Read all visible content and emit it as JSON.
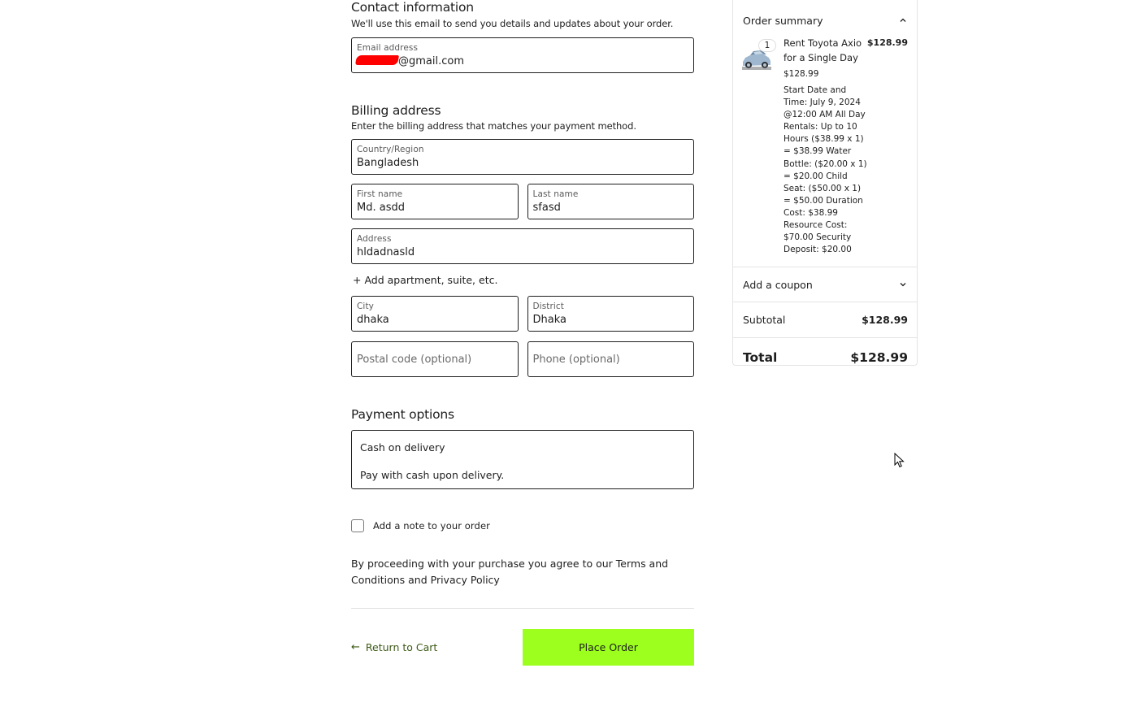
{
  "contact": {
    "title": "Contact information",
    "description": "We'll use this email to send you details and updates about your order.",
    "email_label": "Email address",
    "email_value_visible": "@gmail.com",
    "email_redacted": true
  },
  "billing": {
    "title": "Billing address",
    "description": "Enter the billing address that matches your payment method.",
    "country_label": "Country/Region",
    "country_value": "Bangladesh",
    "first_name_label": "First name",
    "first_name_value": "Md. asdd",
    "last_name_label": "Last name",
    "last_name_value": "sfasd",
    "address_label": "Address",
    "address_value": "hldadnasld",
    "add_apartment": "+ Add apartment, suite, etc.",
    "city_label": "City",
    "city_value": "dhaka",
    "district_label": "District",
    "district_value": "Dhaka",
    "postal_placeholder": "Postal code (optional)",
    "phone_placeholder": "Phone (optional)"
  },
  "payment": {
    "title": "Payment options",
    "method_title": "Cash on delivery",
    "method_description": "Pay with cash upon delivery."
  },
  "note": {
    "label": "Add a note to your order",
    "checked": false
  },
  "terms": {
    "text": "By proceeding with your purchase you agree to our Terms and Conditions and Privacy Policy"
  },
  "actions": {
    "return_label": "Return to Cart",
    "return_icon": "arrow-left-icon",
    "place_order_label": "Place Order"
  },
  "summary": {
    "title": "Order summary",
    "expanded": true,
    "item": {
      "quantity": "1",
      "name": "Rent Toyota Axio for a Single Day",
      "unit_price": "$128.99",
      "line_total": "$128.99",
      "meta": "Start Date and Time: July 9, 2024 @12:00 AM All Day Rentals: Up to 10 Hours ($38.99 x 1) = $38.99 Water Bottle: ($20.00 x 1) = $20.00 Child Seat: ($50.00 x 1) = $50.00 Duration Cost: $38.99 Resource Cost: $70.00 Security Deposit: $20.00",
      "image_icon": "car-thumbnail"
    },
    "coupon_label": "Add a coupon",
    "subtotal_label": "Subtotal",
    "subtotal_value": "$128.99",
    "total_label": "Total",
    "total_value": "$128.99"
  },
  "colors": {
    "accent_button": "#9cff1e",
    "link_green": "#3c5a14",
    "border": "#1e1e1e",
    "redaction": "#ff0000"
  }
}
